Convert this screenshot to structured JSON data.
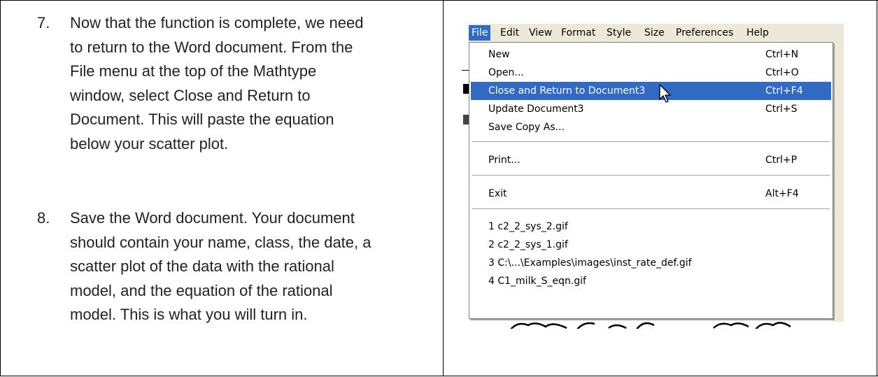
{
  "steps": [
    {
      "num": "7.",
      "lines": [
        "Now that the function is complete, we need",
        "to return to the Word document. From the",
        "File menu at the top of the Mathtype",
        "window, select Close and Return to",
        "Document. This will paste the equation",
        "below your scatter plot."
      ]
    },
    {
      "num": "8.",
      "lines": [
        "Save the Word document. Your document",
        "should contain your name, class, the date, a",
        "scatter plot of the data with the rational",
        "model, and the equation of the rational",
        "model. This is what you will turn in."
      ]
    }
  ],
  "menubar": [
    "File",
    "Edit",
    "View",
    "Format",
    "Style",
    "Size",
    "Preferences",
    "Help"
  ],
  "menu": {
    "group1": [
      {
        "label": "New",
        "shortcut": "Ctrl+N"
      },
      {
        "label": "Open...",
        "shortcut": "Ctrl+O"
      },
      {
        "label": "Close and Return to Document3",
        "shortcut": "Ctrl+F4",
        "highlighted": true
      },
      {
        "label": "Update Document3",
        "shortcut": "Ctrl+S"
      },
      {
        "label": "Save Copy As...",
        "shortcut": ""
      }
    ],
    "group2": [
      {
        "label": "Print...",
        "shortcut": "Ctrl+P"
      }
    ],
    "group3": [
      {
        "label": "Exit",
        "shortcut": "Alt+F4"
      }
    ],
    "recent": [
      {
        "label": "1 c2_2_sys_2.gif"
      },
      {
        "label": "2 c2_2_sys_1.gif"
      },
      {
        "label": "3 C:\\...\\Examples\\images\\inst_rate_def.gif"
      },
      {
        "label": "4 C1_milk_S_eqn.gif"
      }
    ]
  },
  "colors": {
    "highlight": "#316ac5",
    "menubar_bg": "#ece9d8"
  },
  "icons": [
    "mouse-pointer-icon"
  ]
}
